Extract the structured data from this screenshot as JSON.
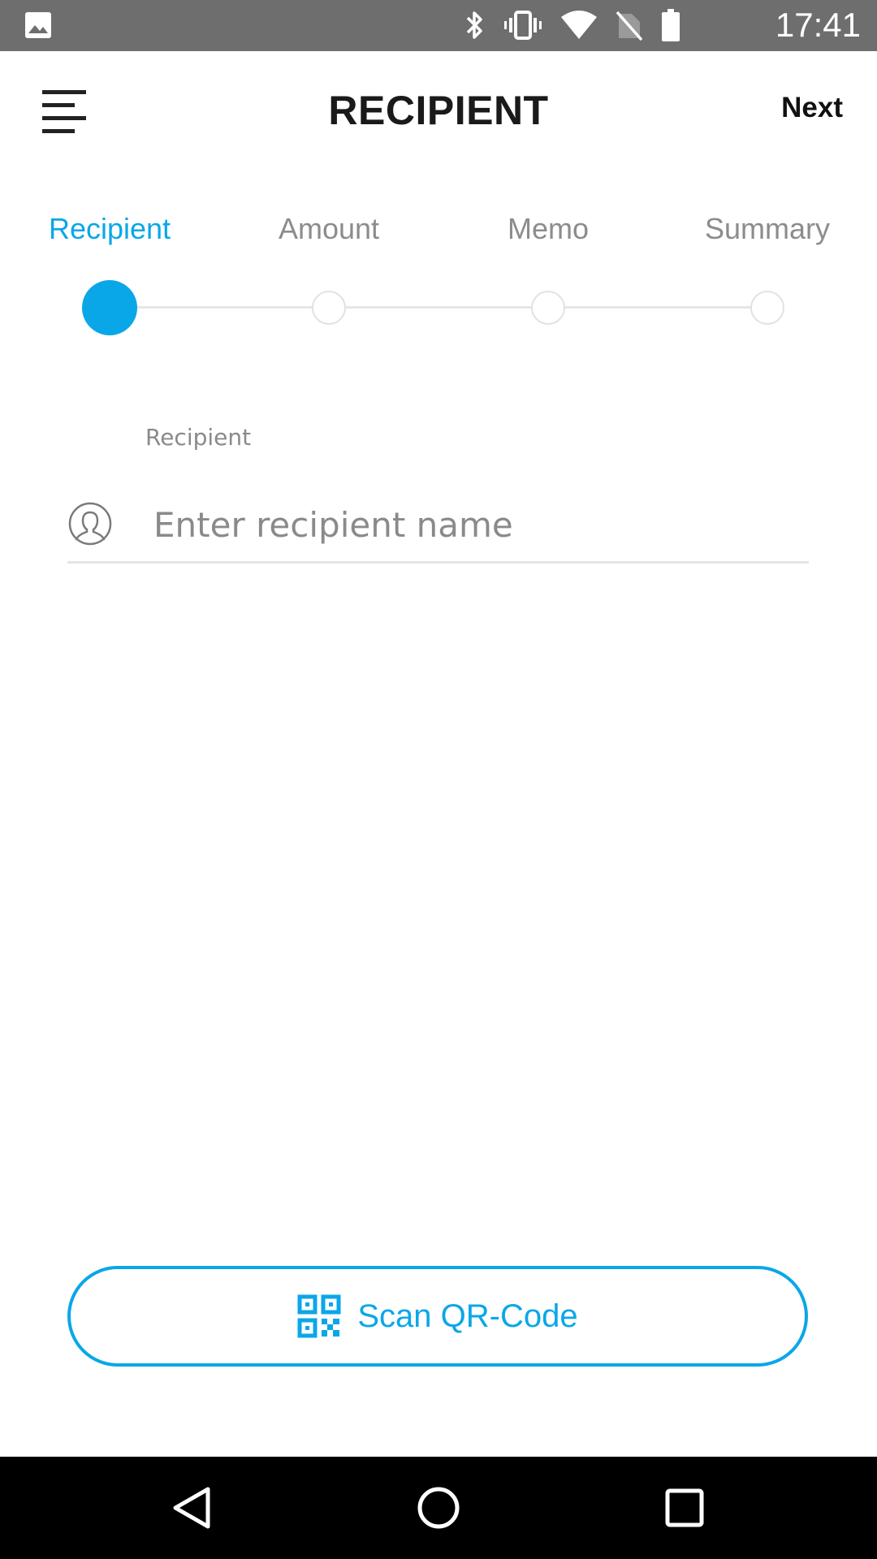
{
  "status_bar": {
    "time": "17:41",
    "icons": [
      "gallery-icon",
      "bluetooth-icon",
      "vibrate-icon",
      "wifi-icon",
      "no-sim-icon",
      "battery-icon"
    ]
  },
  "app_bar": {
    "title": "RECIPIENT",
    "next_label": "Next",
    "menu_icon": "menu-icon"
  },
  "steps": [
    {
      "label": "Recipient",
      "active": true
    },
    {
      "label": "Amount",
      "active": false
    },
    {
      "label": "Memo",
      "active": false
    },
    {
      "label": "Summary",
      "active": false
    }
  ],
  "recipient_field": {
    "label": "Recipient",
    "value": "",
    "placeholder": "Enter recipient name",
    "icon": "person-icon"
  },
  "scan_button": {
    "label": "Scan QR-Code",
    "icon": "qr-code-icon"
  },
  "nav_bar": {
    "icons": [
      "back-icon",
      "home-icon",
      "recents-icon"
    ]
  },
  "colors": {
    "accent": "#0aa7e8",
    "status_bar": "#6e6e6e",
    "nav_bar": "#000000",
    "inactive_text": "#8c8c8c"
  }
}
